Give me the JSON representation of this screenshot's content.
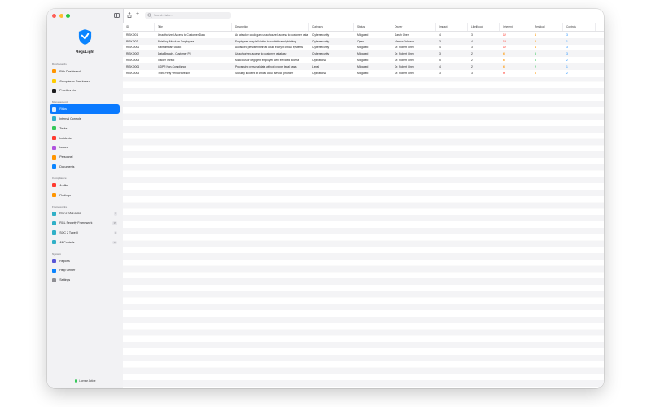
{
  "app": {
    "name": "ReguLight",
    "license_status": "License Active"
  },
  "toolbar": {
    "search_placeholder": "Search risks..."
  },
  "sidebar": {
    "sections": [
      {
        "label": "Dashboards",
        "items": [
          {
            "label": "Risk Dashboard",
            "icon": "gauge-icon",
            "color": "#ff9500"
          },
          {
            "label": "Compliance Dashboard",
            "icon": "checkmark-shield-icon",
            "color": "#ffcc00"
          },
          {
            "label": "Priorities List",
            "icon": "list-icon",
            "color": "#1d1d1f"
          }
        ]
      },
      {
        "label": "Management",
        "items": [
          {
            "label": "Risks",
            "icon": "warning-icon",
            "color": "#ff3b30",
            "active": true
          },
          {
            "label": "Internal Controls",
            "icon": "shield-icon",
            "color": "#30b0c7"
          },
          {
            "label": "Tasks",
            "icon": "checklist-icon",
            "color": "#34c759"
          },
          {
            "label": "Incidents",
            "icon": "flame-icon",
            "color": "#ff3b30"
          },
          {
            "label": "Issues",
            "icon": "exclamation-icon",
            "color": "#af52de"
          },
          {
            "label": "Personnel",
            "icon": "people-icon",
            "color": "#ff9500"
          },
          {
            "label": "Documents",
            "icon": "document-icon",
            "color": "#0a84ff"
          }
        ]
      },
      {
        "label": "Compliance",
        "items": [
          {
            "label": "Audits",
            "icon": "magnifier-icon",
            "color": "#ff3b30"
          },
          {
            "label": "Findings",
            "icon": "flag-icon",
            "color": "#ff9500"
          }
        ]
      },
      {
        "label": "Frameworks",
        "items": [
          {
            "label": "ISO 27001:2022",
            "icon": "building-icon",
            "color": "#30b0c7",
            "count": "4"
          },
          {
            "label": "RGL Security Framework",
            "icon": "building-icon",
            "color": "#30b0c7",
            "count": "35"
          },
          {
            "label": "SOC 2 Type II",
            "icon": "building-icon",
            "color": "#30b0c7",
            "count": "1"
          },
          {
            "label": "All Controls",
            "icon": "grid-icon",
            "color": "#30b0c7",
            "count": "40"
          }
        ]
      },
      {
        "label": "System",
        "items": [
          {
            "label": "Reports",
            "icon": "chart-icon",
            "color": "#5856d6"
          },
          {
            "label": "Help Center",
            "icon": "question-icon",
            "color": "#0a84ff"
          },
          {
            "label": "Settings",
            "icon": "gear-icon",
            "color": "#8e8e93"
          }
        ]
      }
    ]
  },
  "table": {
    "headers": [
      "ID",
      "Title",
      "Description",
      "Category",
      "Status",
      "Owner",
      "Impact",
      "Likelihood",
      "Inherent",
      "Residual",
      "Controls"
    ],
    "rows": [
      {
        "id": "RISK-001",
        "title": "Unauthorized Access to Customer Data",
        "description": "An attacker could gain unauthorized access to customer data",
        "category": "Cybersecurity",
        "status": "Mitigated",
        "owner": "Sarah Chen",
        "impact": "4",
        "likelihood": "3",
        "inherent": "12",
        "inherent_color": "red",
        "residual": "4",
        "residual_color": "orange",
        "controls": "3"
      },
      {
        "id": "RISK-002",
        "title": "Phishing Attack on Employees",
        "description": "Employees may fall victim to sophisticated phishing",
        "category": "Cybersecurity",
        "status": "Open",
        "owner": "Marcus Johnson",
        "impact": "3",
        "likelihood": "4",
        "inherent": "12",
        "inherent_color": "red",
        "residual": "4",
        "residual_color": "orange",
        "controls": "1"
      },
      {
        "id": "RISK-0001",
        "title": "Ransomware Attack",
        "description": "Advanced persistent threat could encrypt critical systems",
        "category": "Cybersecurity",
        "status": "Mitigated",
        "owner": "Dr. Robert Chen",
        "impact": "4",
        "likelihood": "3",
        "inherent": "12",
        "inherent_color": "red",
        "residual": "4",
        "residual_color": "orange",
        "controls": "3"
      },
      {
        "id": "RISK-0002",
        "title": "Data Breach - Customer PII",
        "description": "Unauthorized access to customer database",
        "category": "Cybersecurity",
        "status": "Mitigated",
        "owner": "Dr. Robert Chen",
        "impact": "3",
        "likelihood": "2",
        "inherent": "6",
        "inherent_color": "orange",
        "residual": "3",
        "residual_color": "green",
        "controls": "3"
      },
      {
        "id": "RISK-0003",
        "title": "Insider Threat",
        "description": "Malicious or negligent employee with elevated access",
        "category": "Operational",
        "status": "Mitigated",
        "owner": "Dr. Robert Chen",
        "impact": "5",
        "likelihood": "2",
        "inherent": "6",
        "inherent_color": "orange",
        "residual": "3",
        "residual_color": "green",
        "controls": "2"
      },
      {
        "id": "RISK-0004",
        "title": "GDPR Non-Compliance",
        "description": "Processing personal data without proper legal basis",
        "category": "Legal",
        "status": "Mitigated",
        "owner": "Dr. Robert Chen",
        "impact": "4",
        "likelihood": "2",
        "inherent": "6",
        "inherent_color": "orange",
        "residual": "2",
        "residual_color": "green",
        "controls": "1"
      },
      {
        "id": "RISK-0005",
        "title": "Third-Party Vendor Breach",
        "description": "Security incident at critical cloud service provider",
        "category": "Operational",
        "status": "Mitigated",
        "owner": "Dr. Robert Chen",
        "impact": "3",
        "likelihood": "3",
        "inherent": "9",
        "inherent_color": "red",
        "residual": "3",
        "residual_color": "orange",
        "controls": "2"
      }
    ]
  }
}
